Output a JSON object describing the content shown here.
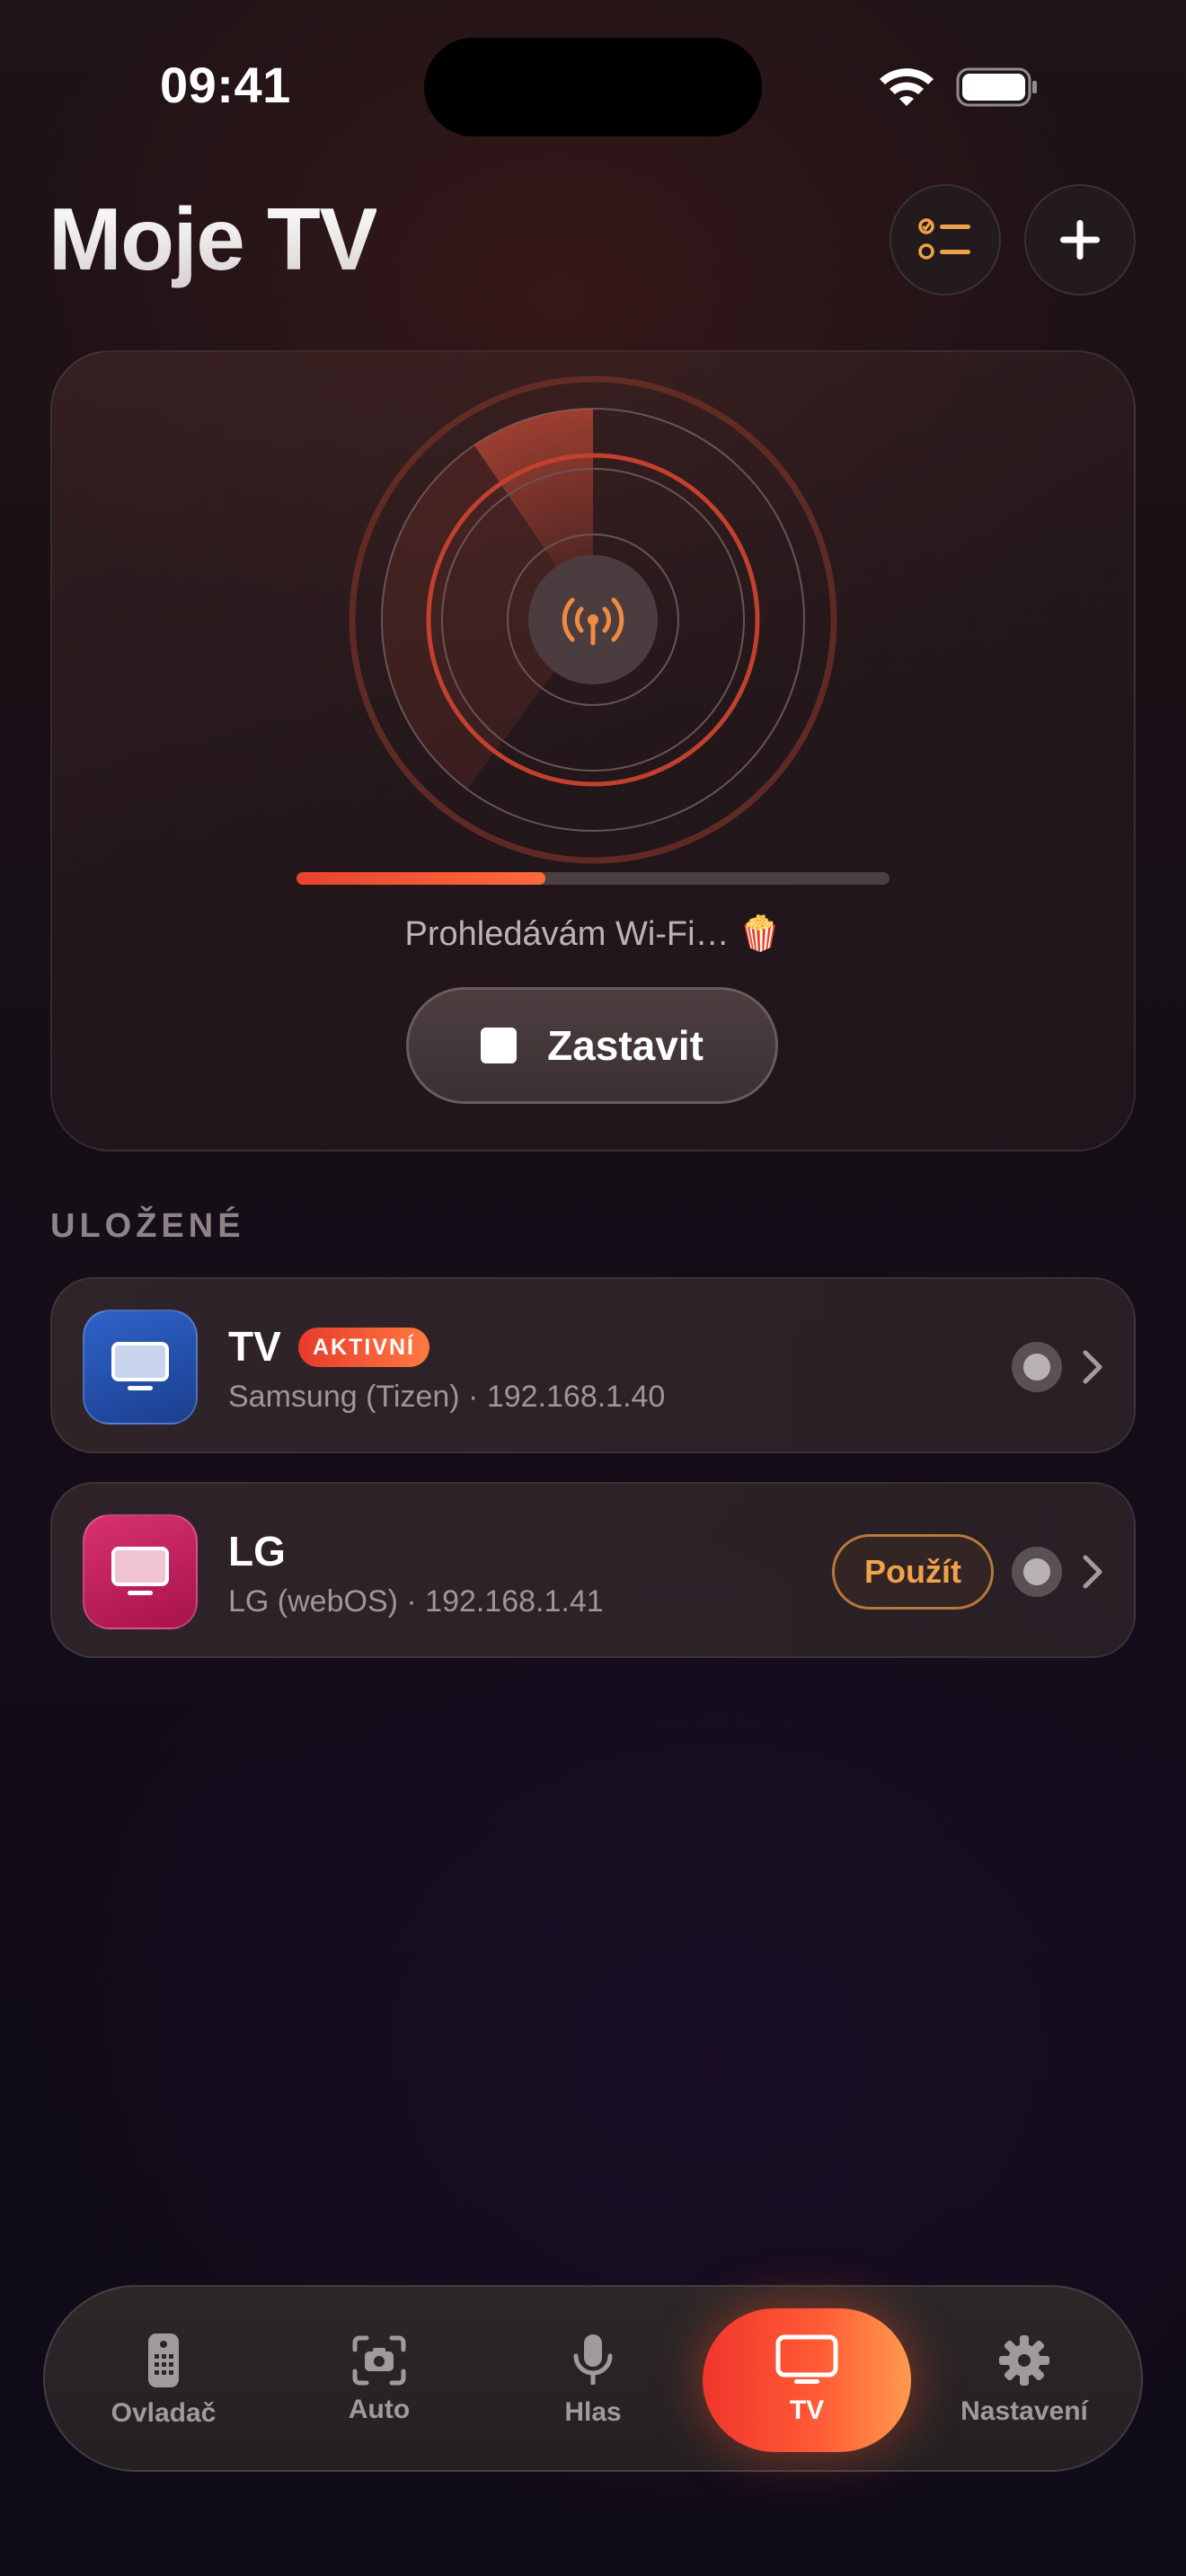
{
  "status_bar": {
    "time": "09:41"
  },
  "header": {
    "title": "Moje TV",
    "checklist_icon": "checklist-icon",
    "add_icon": "plus-icon"
  },
  "scan": {
    "progress_percent": 42,
    "status_text": "Prohledávám Wi-Fi… 🍿",
    "stop_label": "Zastavit",
    "icon": "antenna-icon"
  },
  "saved": {
    "section_title": "ULOŽENÉ",
    "devices": [
      {
        "name": "TV",
        "badge": "AKTIVNÍ",
        "subtitle": "Samsung (Tizen) · 192.168.1.40",
        "color": "#2b5bb8"
      },
      {
        "name": "LG",
        "subtitle": "LG (webOS) · 192.168.1.41",
        "action": "Použít",
        "color": "#c21f5c"
      }
    ]
  },
  "tabbar": {
    "tabs": [
      {
        "label": "Ovladač",
        "icon": "remote-icon"
      },
      {
        "label": "Auto",
        "icon": "camera-icon"
      },
      {
        "label": "Hlas",
        "icon": "microphone-icon"
      },
      {
        "label": "TV",
        "icon": "tv-icon",
        "active": true
      },
      {
        "label": "Nastavení",
        "icon": "gear-icon"
      }
    ]
  },
  "colors": {
    "accent": "#ff5a35",
    "accent_orange": "#f0a24a",
    "background": "#150e17"
  }
}
